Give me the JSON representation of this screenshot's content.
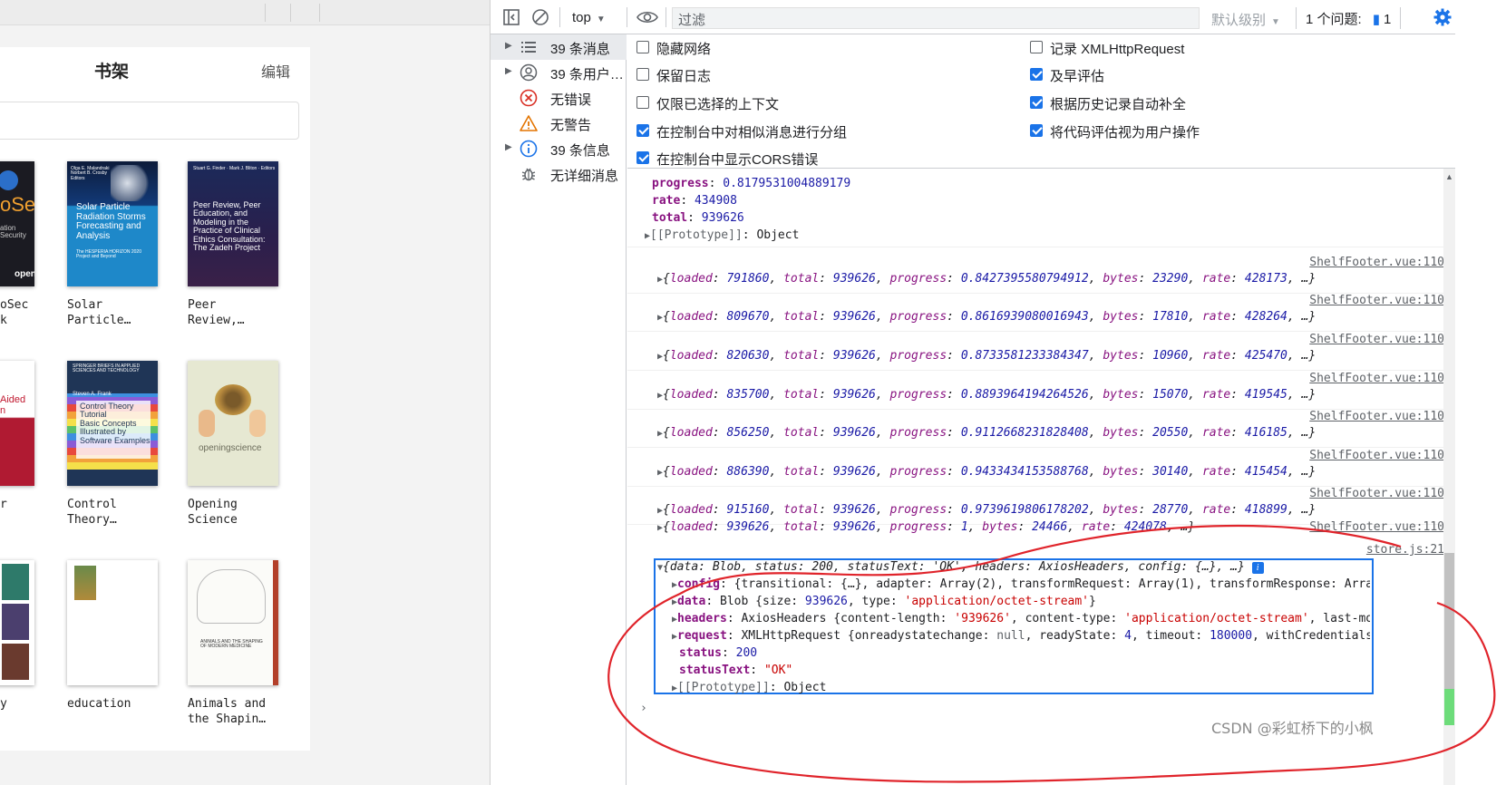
{
  "app": {
    "shelf_title": "书架",
    "edit_label": "编辑",
    "books": [
      {
        "title": "oSec\nk",
        "cover": "dark",
        "cover_text": "oSec",
        "cover_sub": "ation Security",
        "cover_badge": "open"
      },
      {
        "title": "Solar\nParticle…",
        "cover": "blue",
        "cover_text": "Solar Particle Radiation Storms Forecasting and Analysis",
        "cover_sub": "The HESPERIA HORIZON 2020 Project and Beyond",
        "cover_authors": "Olga E. Malandraki\nNorbert B. Crosby\nEditors"
      },
      {
        "title": "Peer\nReview,…",
        "cover": "navy",
        "cover_text": "Peer Review, Peer Education, and Modeling in the Practice of Clinical Ethics Consultation: The Zadeh Project",
        "cover_authors": "Stuart G. Finder · Mark J. Bliton · Editors"
      },
      {
        "title": "r",
        "cover": "red",
        "cover_text": "Aided\nn"
      },
      {
        "title": "Control\nTheory…",
        "cover": "stripes",
        "cover_text": "Control Theory Tutorial\nBasic Concepts Illustrated by Software Examples",
        "cover_series": "SPRINGER BRIEFS IN APPLIED SCIENCES AND TECHNOLOGY",
        "cover_authors": "Steven A. Frank"
      },
      {
        "title": "Opening\nScience",
        "cover": "sage",
        "cover_text": "openingscience"
      },
      {
        "title": "y",
        "cover": "collage"
      },
      {
        "title": "education",
        "cover": "blank"
      },
      {
        "title": "Animals and\nthe Shapin…",
        "cover": "sketch",
        "cover_text": "ANIMALS AND THE SHAPING OF MODERN MEDICINE"
      }
    ]
  },
  "devtools": {
    "context": "top",
    "filter_placeholder": "过滤",
    "levels": "默认级别",
    "issues_label": "1 个问题:",
    "issues_count": "1",
    "sidebar": [
      {
        "label": "39 条消息",
        "icon": "list-icon",
        "expandable": true,
        "selected": true
      },
      {
        "label": "39 条用户…",
        "icon": "user-icon",
        "expandable": true,
        "selected": false
      },
      {
        "label": "无错误",
        "icon": "error-icon",
        "expandable": false,
        "selected": false
      },
      {
        "label": "无警告",
        "icon": "warning-icon",
        "expandable": false,
        "selected": false
      },
      {
        "label": "39 条信息",
        "icon": "info-icon",
        "expandable": true,
        "selected": false
      },
      {
        "label": "无详细消息",
        "icon": "bug-icon",
        "expandable": false,
        "selected": false
      }
    ],
    "settings_left": [
      {
        "label": "隐藏网络",
        "checked": false
      },
      {
        "label": "保留日志",
        "checked": false
      },
      {
        "label": "仅限已选择的上下文",
        "checked": false
      },
      {
        "label": "在控制台中对相似消息进行分组",
        "checked": true
      },
      {
        "label": "在控制台中显示CORS错误",
        "checked": true
      }
    ],
    "settings_right": [
      {
        "label": "记录 XMLHttpRequest",
        "checked": false
      },
      {
        "label": "及早评估",
        "checked": true
      },
      {
        "label": "根据历史记录自动补全",
        "checked": true
      },
      {
        "label": "将代码评估视为用户操作",
        "checked": true
      }
    ],
    "expanded_top": {
      "progress": "0.8179531004889179",
      "rate": "434908",
      "total": "939626",
      "prototype": "Object"
    },
    "log_source": "ShelfFooter.vue:110",
    "logs": [
      {
        "loaded": "791860",
        "total": "939626",
        "progress": "0.8427395580794912",
        "bytes": "23290",
        "rate": "428173"
      },
      {
        "loaded": "809670",
        "total": "939626",
        "progress": "0.8616939080016943",
        "bytes": "17810",
        "rate": "428264"
      },
      {
        "loaded": "820630",
        "total": "939626",
        "progress": "0.8733581233384347",
        "bytes": "10960",
        "rate": "425470"
      },
      {
        "loaded": "835700",
        "total": "939626",
        "progress": "0.8893964194264526",
        "bytes": "15070",
        "rate": "419545"
      },
      {
        "loaded": "856250",
        "total": "939626",
        "progress": "0.9112668231828408",
        "bytes": "20550",
        "rate": "416185"
      },
      {
        "loaded": "886390",
        "total": "939626",
        "progress": "0.9433434153588768",
        "bytes": "30140",
        "rate": "415454"
      },
      {
        "loaded": "915160",
        "total": "939626",
        "progress": "0.9739619806178202",
        "bytes": "28770",
        "rate": "418899"
      },
      {
        "loaded": "939626",
        "total": "939626",
        "progress": "1",
        "bytes": "24466",
        "rate": "424078"
      }
    ],
    "response": {
      "source": "store.js:21",
      "summary": "{data: Blob, status: 200, statusText: 'OK', headers: AxiosHeaders, config: {…}, …}",
      "config": "{transitional: {…}, adapter: Array(2), transformRequest: Array(1), transformResponse: Array",
      "data": "Blob {size: 939626, type: 'application/octet-stream'}",
      "headers": "AxiosHeaders {content-length: '939626', content-type: 'application/octet-stream', last-mo",
      "request": "XMLHttpRequest {onreadystatechange: null, readyState: 4, timeout: 180000, withCredentials",
      "status": "200",
      "statusText": "\"OK\"",
      "prototype": "Object"
    }
  },
  "watermark": "CSDN @彩虹桥下的小枫",
  "colors": {
    "accent": "#1a73e8",
    "annotation": "#e0242b",
    "key": "#881280",
    "number": "#1a1aa6",
    "string": "#c80000"
  }
}
